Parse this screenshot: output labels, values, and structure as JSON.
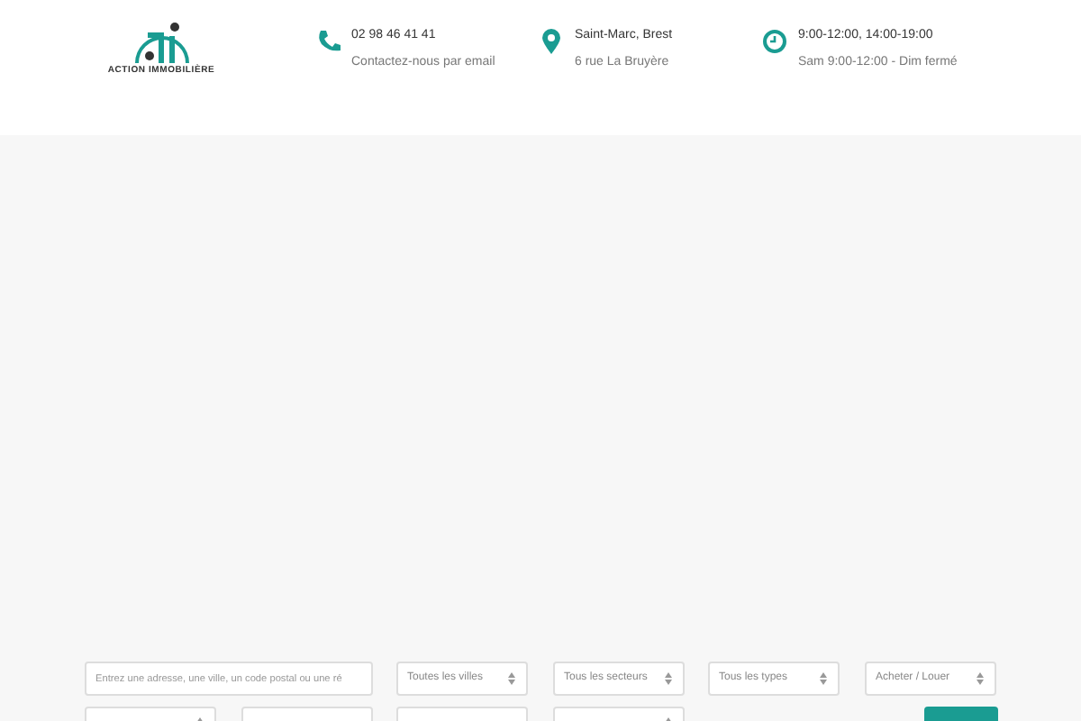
{
  "logo": {
    "name": "ACTION IMMOBILIÈRE"
  },
  "contacts": [
    {
      "kind": "phone",
      "title": "02 98 46 41 41",
      "subtitle": "Contactez-nous par email"
    },
    {
      "kind": "location",
      "title": "Saint-Marc, Brest",
      "subtitle": "6 rue La Bruyère"
    },
    {
      "kind": "clock",
      "title": "9:00-12:00, 14:00-19:00",
      "subtitle": "Sam 9:00-12:00 - Dim fermé"
    }
  ],
  "search_rows": [
    [
      {
        "kind": "text",
        "placeholder": "Entrez une adresse, une ville, un code postal ou une ré"
      },
      {
        "kind": "select",
        "value": "Toutes les villes"
      },
      {
        "kind": "select",
        "value": "Tous les secteurs"
      },
      {
        "kind": "select",
        "value": "Tous les types"
      },
      {
        "kind": "select",
        "value": "Acheter / Louer"
      }
    ],
    [
      {
        "kind": "select"
      },
      {
        "kind": "text"
      },
      {
        "kind": "text"
      },
      {
        "kind": "select"
      },
      {
        "kind": "button"
      }
    ]
  ]
}
